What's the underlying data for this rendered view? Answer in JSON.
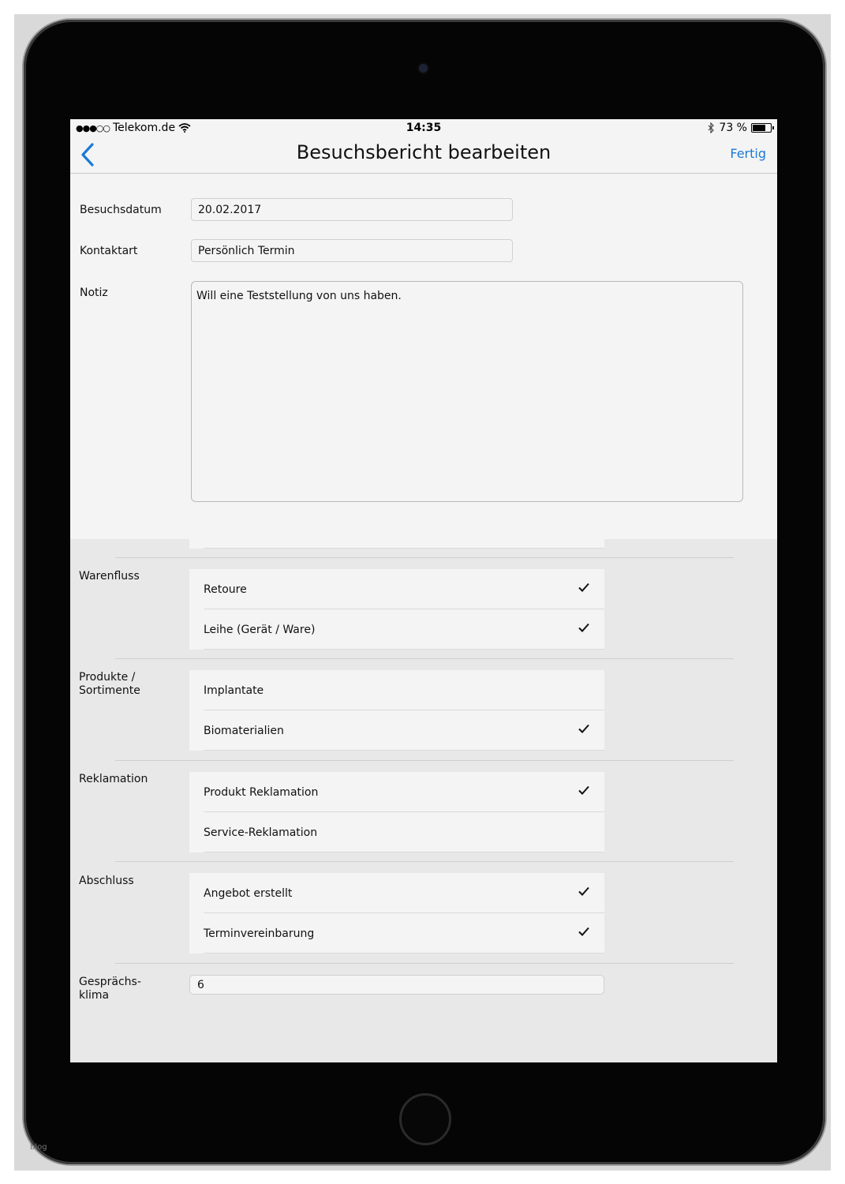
{
  "status": {
    "signal": "●●●○○",
    "carrier": "Telekom.de",
    "time": "14:35",
    "battery_text": "73 %",
    "battery_level": 0.73
  },
  "nav": {
    "back_glyph": "‹",
    "title": "Besuchsbericht bearbeiten",
    "done": "Fertig"
  },
  "form": {
    "date_label": "Besuchsdatum",
    "date_value": "20.02.2017",
    "contact_label": "Kontaktart",
    "contact_value": "Persönlich Termin",
    "note_label": "Notiz",
    "note_value": "Will eine Teststellung von uns haben."
  },
  "sections": [
    {
      "label_lines": [
        "Warenfluss"
      ],
      "items": [
        {
          "label": "Retoure",
          "checked": true
        },
        {
          "label": "Leihe (Gerät / Ware)",
          "checked": true
        }
      ]
    },
    {
      "label_lines": [
        "Produkte /",
        "Sortimente"
      ],
      "items": [
        {
          "label": "Implantate",
          "checked": false
        },
        {
          "label": "Biomaterialien",
          "checked": true
        }
      ]
    },
    {
      "label_lines": [
        "Reklamation"
      ],
      "items": [
        {
          "label": "Produkt Reklamation",
          "checked": true
        },
        {
          "label": "Service-Reklamation",
          "checked": false
        }
      ]
    },
    {
      "label_lines": [
        "Abschluss"
      ],
      "items": [
        {
          "label": "Angebot erstellt",
          "checked": true
        },
        {
          "label": "Terminvereinbarung",
          "checked": true
        }
      ]
    }
  ],
  "climate": {
    "label_line1": "Gesprächs-",
    "label_line2": "klima",
    "value": "6"
  },
  "footer_text": "blog",
  "colors": {
    "accent": "#1a7ad6"
  }
}
